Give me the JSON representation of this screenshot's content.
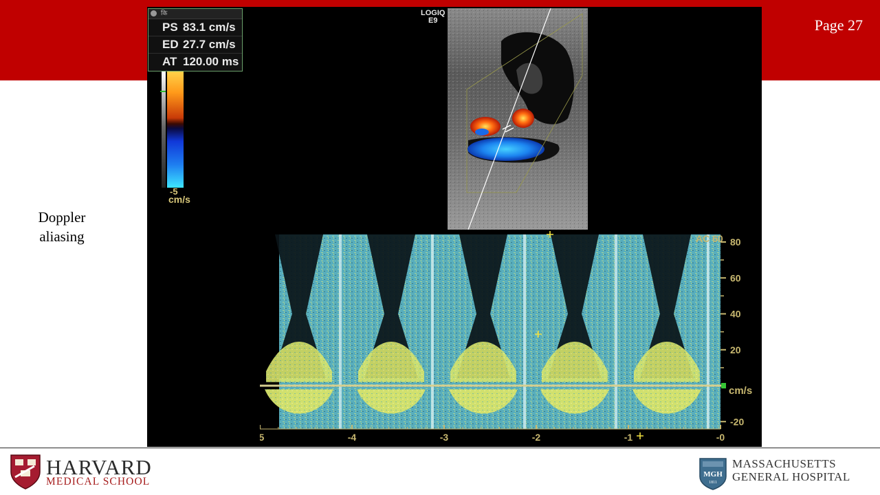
{
  "slide": {
    "page_label": "Page 27",
    "side_label_line1": "Doppler",
    "side_label_line2": "aliasing"
  },
  "measurements": {
    "header_text": "कि",
    "rows": [
      {
        "label": "PS",
        "value": "83.1 cm/s"
      },
      {
        "label": "ED",
        "value": "27.7 cm/s"
      },
      {
        "label": "AT",
        "value": "120.00 ms"
      }
    ]
  },
  "color_scale": {
    "min_label": "-5",
    "unit": "cm/s"
  },
  "device": {
    "line1": "LOGIQ",
    "line2": "E9"
  },
  "spectral": {
    "ac_label": "AC 60",
    "unit_label": "cm/s",
    "y_ticks": [
      80,
      60,
      40,
      20,
      -20
    ],
    "x_ticks": [
      -5,
      -4,
      -3,
      -2,
      -1,
      0
    ],
    "x_tick_labels": [
      "-5",
      "-4",
      "-3",
      "-2",
      "-1",
      "-0"
    ]
  },
  "logos": {
    "harvard_line1": "HARVARD",
    "harvard_line2": "MEDICAL SCHOOL",
    "mgh_line1": "MASSACHUSETTS",
    "mgh_line2": "GENERAL HOSPITAL",
    "mgh_seal_text": "MGH",
    "mgh_seal_year": "1811"
  },
  "colors": {
    "banner": "#c00000",
    "scale_text": "#d9c87a",
    "spectral_cyan": "#5fb8c8",
    "spectral_yellow": "#e8ea6a"
  }
}
